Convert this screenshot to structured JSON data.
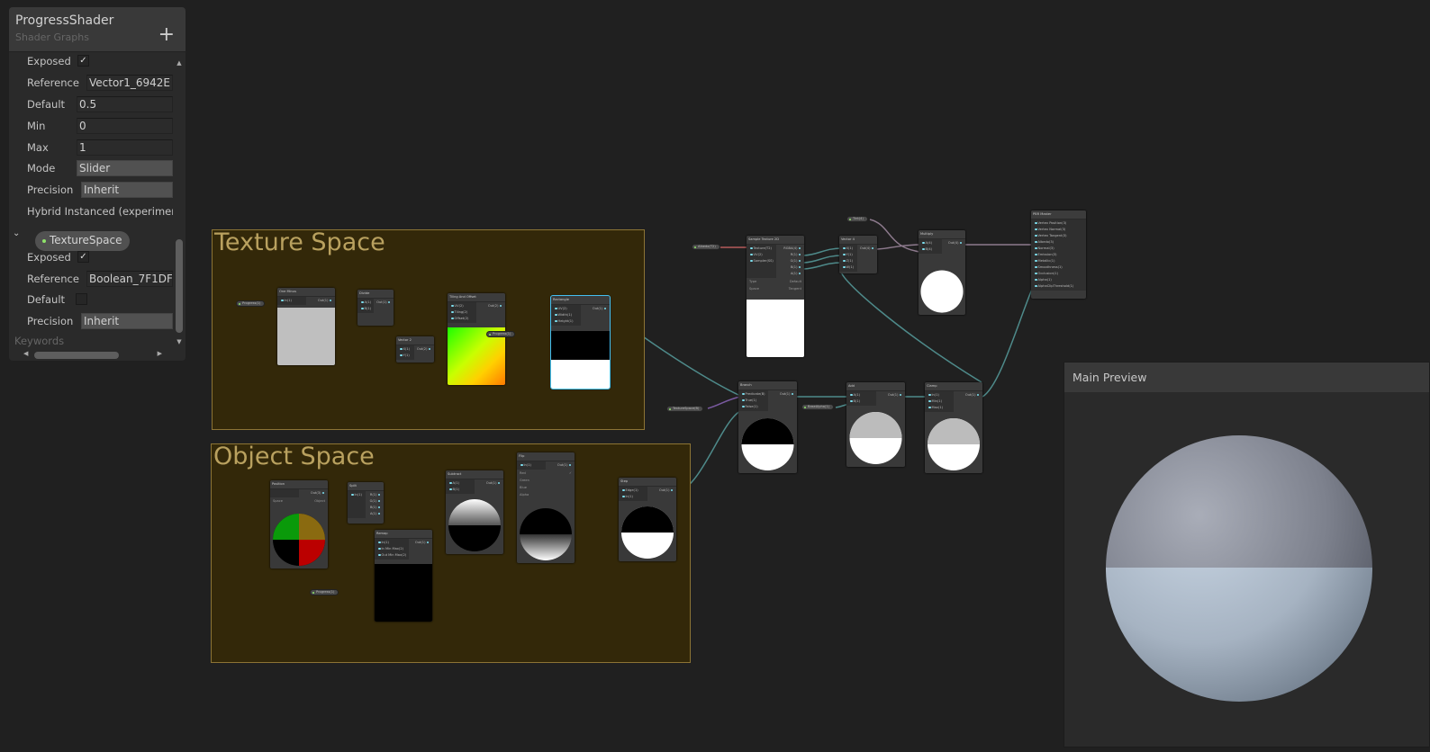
{
  "blackboard": {
    "title": "ProgressShader",
    "subtitle": "Shader Graphs",
    "add_icon": "plus-icon",
    "progress_props": {
      "exposed_label": "Exposed",
      "exposed": true,
      "reference_label": "Reference",
      "reference": "Vector1_6942E",
      "default_label": "Default",
      "default": "0.5",
      "min_label": "Min",
      "min": "0",
      "max_label": "Max",
      "max": "1",
      "mode_label": "Mode",
      "mode": "Slider",
      "precision_label": "Precision",
      "precision": "Inherit",
      "hybrid_label": "Hybrid Instanced (experimental)"
    },
    "texturespace": {
      "name": "TextureSpace",
      "exposed_label": "Exposed",
      "exposed": true,
      "reference_label": "Reference",
      "reference": "Boolean_7F1DF",
      "default_label": "Default",
      "default": false,
      "precision_label": "Precision",
      "precision": "Inherit"
    },
    "keywords_label": "Keywords"
  },
  "groups": [
    {
      "title": "Texture Space"
    },
    {
      "title": "Object Space"
    }
  ],
  "properties": [
    {
      "label": "Progress(1)"
    },
    {
      "label": "Progress(1)"
    },
    {
      "label": "Progress(1)"
    },
    {
      "label": "Albedo(T2)"
    },
    {
      "label": "Tint(4)"
    },
    {
      "label": "TextureSpace(B)"
    },
    {
      "label": "BaseAlpha(1)"
    }
  ],
  "nodes": [
    {
      "id": "oneminus",
      "title": "One Minus",
      "inputs": [
        "In(1)"
      ],
      "outputs": [
        "Out(1)"
      ]
    },
    {
      "id": "divide",
      "title": "Divide",
      "inputs": [
        "A(1)",
        "B(1)"
      ],
      "outputs": [
        "Out(1)"
      ]
    },
    {
      "id": "vector2",
      "title": "Vector 2",
      "inputs": [
        "X(1)",
        "Y(1)"
      ],
      "outputs": [
        "Out(2)"
      ]
    },
    {
      "id": "tiling",
      "title": "Tiling And Offset",
      "inputs": [
        "UV(2)",
        "Tiling(2)",
        "Offset(2)"
      ],
      "outputs": [
        "Out(2)"
      ]
    },
    {
      "id": "rectangle",
      "title": "Rectangle",
      "inputs": [
        "UV(2)",
        "Width(1)",
        "Height(1)"
      ],
      "outputs": [
        "Out(1)"
      ]
    },
    {
      "id": "position",
      "title": "Position",
      "inputs": [],
      "outputs": [
        "Out(3)"
      ],
      "options": [
        [
          "Space",
          "Object"
        ]
      ]
    },
    {
      "id": "split",
      "title": "Split",
      "inputs": [
        "In(1)"
      ],
      "outputs": [
        "R(1)",
        "G(1)",
        "B(1)",
        "A(1)"
      ]
    },
    {
      "id": "remap",
      "title": "Remap",
      "inputs": [
        "In(1)",
        "In Min Max(2)",
        "Out Min Max(2)"
      ],
      "outputs": [
        "Out(1)"
      ]
    },
    {
      "id": "subtract",
      "title": "Subtract",
      "inputs": [
        "A(1)",
        "B(1)"
      ],
      "outputs": [
        "Out(1)"
      ]
    },
    {
      "id": "flip",
      "title": "Flip",
      "inputs": [
        "In(1)"
      ],
      "outputs": [
        "Out(1)"
      ],
      "options": [
        [
          "Red",
          "✓"
        ],
        [
          "Green",
          ""
        ],
        [
          "Blue",
          ""
        ],
        [
          "Alpha",
          ""
        ]
      ]
    },
    {
      "id": "step",
      "title": "Step",
      "inputs": [
        "Edge(1)",
        "In(1)"
      ],
      "outputs": [
        "Out(1)"
      ]
    },
    {
      "id": "sample",
      "title": "Sample Texture 2D",
      "inputs": [
        "Texture(T2)",
        "UV(2)",
        "Sampler(SS)"
      ],
      "outputs": [
        "RGBA(4)",
        "R(1)",
        "G(1)",
        "B(1)",
        "A(1)"
      ],
      "options": [
        [
          "Type",
          "Default"
        ],
        [
          "Space",
          "Tangent"
        ]
      ]
    },
    {
      "id": "vector4",
      "title": "Vector 4",
      "inputs": [
        "X(1)",
        "Y(1)",
        "Z(1)",
        "W(1)"
      ],
      "outputs": [
        "Out(4)"
      ]
    },
    {
      "id": "multiply",
      "title": "Multiply",
      "inputs": [
        "A(4)",
        "B(4)"
      ],
      "outputs": [
        "Out(4)"
      ]
    },
    {
      "id": "pbr",
      "title": "PBR Master",
      "inputs": [
        "Vertex Position(3)",
        "Vertex Normal(3)",
        "Vertex Tangent(3)",
        "Albedo(3)",
        "Normal(3)",
        "Emission(3)",
        "Metallic(1)",
        "Smoothness(1)",
        "Occlusion(1)",
        "Alpha(1)",
        "AlphaClipThreshold(1)"
      ],
      "outputs": []
    },
    {
      "id": "branch",
      "title": "Branch",
      "inputs": [
        "Predicate(B)",
        "True(1)",
        "False(1)"
      ],
      "outputs": [
        "Out(1)"
      ]
    },
    {
      "id": "add",
      "title": "Add",
      "inputs": [
        "A(1)",
        "B(1)"
      ],
      "outputs": [
        "Out(1)"
      ]
    },
    {
      "id": "clamp",
      "title": "Clamp",
      "inputs": [
        "In(1)",
        "Min(1)",
        "Max(1)"
      ],
      "outputs": [
        "Out(1)"
      ]
    }
  ],
  "main_preview": {
    "title": "Main Preview"
  },
  "colors": {
    "group_bg": "#332809",
    "group_title": "#b9a15f",
    "selection": "#44c0f0",
    "float_wire": "#4e8a8a",
    "vector_wire": "#8d7a8d",
    "port_dot": "#7ee0f0"
  }
}
